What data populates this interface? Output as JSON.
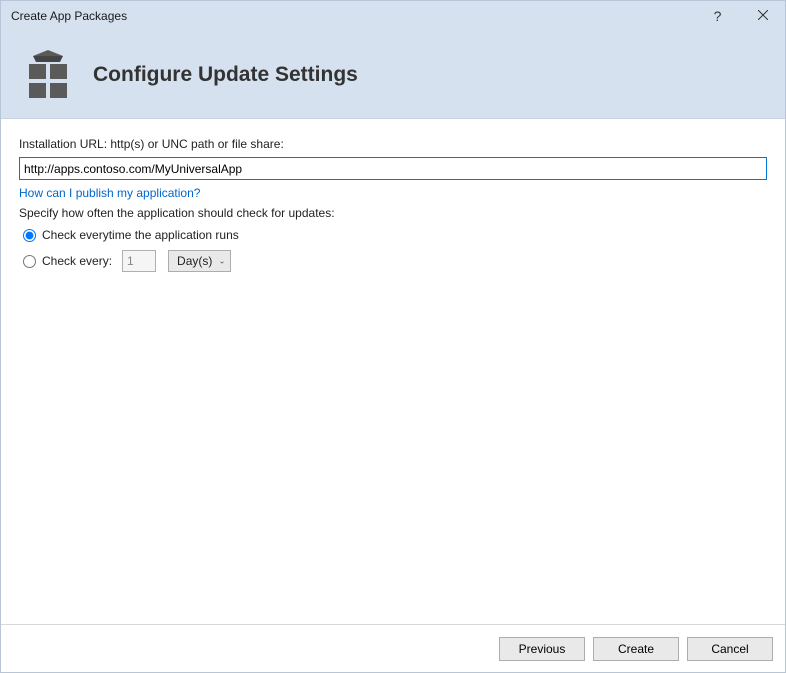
{
  "window": {
    "title": "Create App Packages"
  },
  "header": {
    "heading": "Configure Update Settings"
  },
  "form": {
    "url_label": "Installation URL: http(s) or UNC path or file share:",
    "url_value": "http://apps.contoso.com/MyUniversalApp",
    "publish_link": "How can I publish my application?",
    "specify_label": "Specify how often the application should check for updates:",
    "radio_everytime": "Check everytime the application runs",
    "radio_every": "Check every:",
    "interval_value": "1",
    "interval_unit": "Day(s)"
  },
  "footer": {
    "previous": "Previous",
    "create": "Create",
    "cancel": "Cancel"
  }
}
